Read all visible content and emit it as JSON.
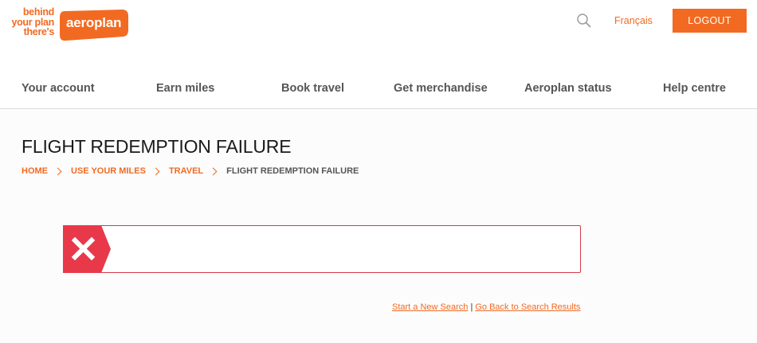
{
  "brand": {
    "tagline_lines": [
      "behind",
      "your plan",
      "there's"
    ],
    "logo_text": "aeroplan",
    "accent_color": "#f26a21",
    "error_color": "#e8394a"
  },
  "header": {
    "search_icon": "search-icon",
    "language_link": "Français",
    "logout_label": "LOGOUT"
  },
  "nav": {
    "items": [
      {
        "label": "Your account"
      },
      {
        "label": "Earn miles"
      },
      {
        "label": "Book travel"
      },
      {
        "label": "Get merchandise"
      },
      {
        "label": "Aeroplan status"
      },
      {
        "label": "Help centre"
      }
    ]
  },
  "page": {
    "title": "FLIGHT REDEMPTION FAILURE",
    "breadcrumb": [
      {
        "label": "HOME"
      },
      {
        "label": "USE YOUR MILES"
      },
      {
        "label": "TRAVEL"
      },
      {
        "label": "FLIGHT REDEMPTION FAILURE"
      }
    ],
    "error": {
      "icon": "close-x-icon",
      "message": ""
    },
    "links": {
      "new_search": "Start a New Search",
      "separator": "|",
      "back_to_results": "Go Back to Search Results"
    }
  }
}
